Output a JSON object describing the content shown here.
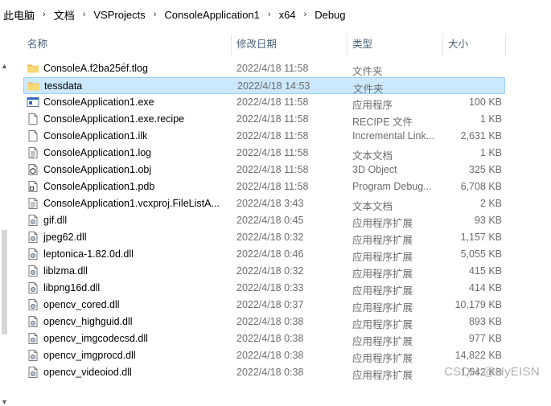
{
  "breadcrumb": {
    "items": [
      "此电脑",
      "文档",
      "VSProjects",
      "ConsoleApplication1",
      "x64",
      "Debug"
    ],
    "separator": "›"
  },
  "columns": {
    "name": "名称",
    "date": "修改日期",
    "type": "类型",
    "size": "大小"
  },
  "files": [
    {
      "name": "ConsoleA.f2ba25ef.tlog",
      "date": "2022/4/18 11:58",
      "type": "文件夹",
      "size": "",
      "icon": "folder-icon"
    },
    {
      "name": "tessdata",
      "date": "2022/4/18 14:53",
      "type": "文件夹",
      "size": "",
      "icon": "folder-icon",
      "selected": true
    },
    {
      "name": "ConsoleApplication1.exe",
      "date": "2022/4/18 11:58",
      "type": "应用程序",
      "size": "100 KB",
      "icon": "exe-icon"
    },
    {
      "name": "ConsoleApplication1.exe.recipe",
      "date": "2022/4/18 11:58",
      "type": "RECIPE 文件",
      "size": "1 KB",
      "icon": "file-icon"
    },
    {
      "name": "ConsoleApplication1.ilk",
      "date": "2022/4/18 11:58",
      "type": "Incremental Link...",
      "size": "2,631 KB",
      "icon": "file-icon"
    },
    {
      "name": "ConsoleApplication1.log",
      "date": "2022/4/18 11:58",
      "type": "文本文档",
      "size": "1 KB",
      "icon": "text-file-icon"
    },
    {
      "name": "ConsoleApplication1.obj",
      "date": "2022/4/18 11:58",
      "type": "3D Object",
      "size": "325 KB",
      "icon": "object-file-icon"
    },
    {
      "name": "ConsoleApplication1.pdb",
      "date": "2022/4/18 11:58",
      "type": "Program Debug...",
      "size": "6,708 KB",
      "icon": "pdb-file-icon"
    },
    {
      "name": "ConsoleApplication1.vcxproj.FileListA...",
      "date": "2022/4/18 3:43",
      "type": "文本文档",
      "size": "2 KB",
      "icon": "text-file-icon"
    },
    {
      "name": "gif.dll",
      "date": "2022/4/18 0:45",
      "type": "应用程序扩展",
      "size": "93 KB",
      "icon": "dll-icon"
    },
    {
      "name": "jpeg62.dll",
      "date": "2022/4/18 0:32",
      "type": "应用程序扩展",
      "size": "1,157 KB",
      "icon": "dll-icon"
    },
    {
      "name": "leptonica-1.82.0d.dll",
      "date": "2022/4/18 0:46",
      "type": "应用程序扩展",
      "size": "5,055 KB",
      "icon": "dll-icon"
    },
    {
      "name": "liblzma.dll",
      "date": "2022/4/18 0:32",
      "type": "应用程序扩展",
      "size": "415 KB",
      "icon": "dll-icon"
    },
    {
      "name": "libpng16d.dll",
      "date": "2022/4/18 0:33",
      "type": "应用程序扩展",
      "size": "414 KB",
      "icon": "dll-icon"
    },
    {
      "name": "opencv_cored.dll",
      "date": "2022/4/18 0:37",
      "type": "应用程序扩展",
      "size": "10,179 KB",
      "icon": "dll-icon"
    },
    {
      "name": "opencv_highguid.dll",
      "date": "2022/4/18 0:38",
      "type": "应用程序扩展",
      "size": "893 KB",
      "icon": "dll-icon"
    },
    {
      "name": "opencv_imgcodecsd.dll",
      "date": "2022/4/18 0:38",
      "type": "应用程序扩展",
      "size": "977 KB",
      "icon": "dll-icon"
    },
    {
      "name": "opencv_imgprocd.dll",
      "date": "2022/4/18 0:38",
      "type": "应用程序扩展",
      "size": "14,822 KB",
      "icon": "dll-icon"
    },
    {
      "name": "opencv_videoiod.dll",
      "date": "2022/4/18 0:38",
      "type": "应用程序扩展",
      "size": "1,542 KB",
      "icon": "dll-icon"
    }
  ],
  "watermark": "CSDN @HyEISN",
  "colors": {
    "selected_bg": "#cce8ff",
    "selected_border": "#99d1ff",
    "header_text": "#4c607a",
    "folder": "#f8d775"
  }
}
